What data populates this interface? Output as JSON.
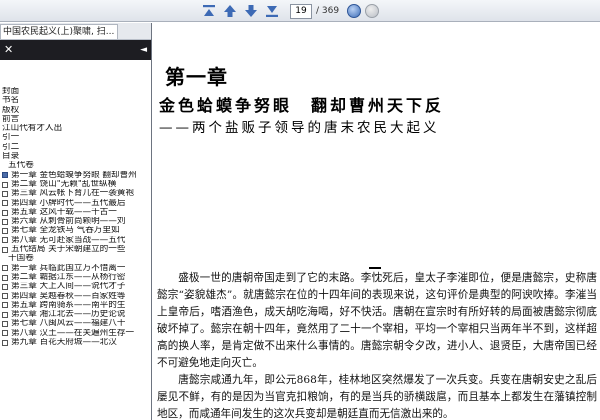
{
  "toolbar": {
    "page_value": "19",
    "page_total": "/ 369",
    "buttons": [
      "first-page-icon",
      "previous-page-icon",
      "next-page-icon",
      "last-page-icon"
    ],
    "accent": "#3f6fb8"
  },
  "sidebar": {
    "tab_title": "中国农民起义(上)聚啸, 扫...",
    "close_label": "✕",
    "items": [
      {
        "type": "plain",
        "text": "封面"
      },
      {
        "type": "plain",
        "text": "书名"
      },
      {
        "type": "plain",
        "text": "版权"
      },
      {
        "type": "plain",
        "text": "前言"
      },
      {
        "type": "plain",
        "text": "江山代有才人出"
      },
      {
        "type": "plain",
        "text": "引一"
      },
      {
        "type": "plain",
        "text": "引二"
      },
      {
        "type": "plain",
        "text": "目录"
      },
      {
        "type": "section",
        "text": "五代卷"
      },
      {
        "type": "sel",
        "text": "第一章  金色蛤蟆争努眼  翻却曹州"
      },
      {
        "type": "box",
        "text": "第二章  饶山\"无赖\"乱世纵横"
      },
      {
        "type": "box",
        "text": "第三章  风云帐下育儿在一袭黄袍"
      },
      {
        "type": "box",
        "text": "第四章  小牌时代——五代最后"
      },
      {
        "type": "box",
        "text": "第五章  这风干载——千古一"
      },
      {
        "type": "box",
        "text": "第六章  从刺骨前尚颗明——刘"
      },
      {
        "type": "box",
        "text": "第七章  全龙铁马  气吞万里如"
      },
      {
        "type": "box",
        "text": "第八章  无可赴家当战——五代"
      },
      {
        "type": "box",
        "text": "五代结局  关于宋朝建立的一些"
      },
      {
        "type": "section",
        "text": "十国卷"
      },
      {
        "type": "box",
        "text": "第一章  兵临此国立万不惜离一"
      },
      {
        "type": "box",
        "text": "第二章  霸据江东——从杨行密"
      },
      {
        "type": "box",
        "text": "第三章  大上人间——说代才子"
      },
      {
        "type": "box",
        "text": "第四章  吴越春秋——百家姓等"
      },
      {
        "type": "box",
        "text": "第五章  跨南骑系——南平的生"
      },
      {
        "type": "box",
        "text": "第六章  湘江北去——历史论说"
      },
      {
        "type": "box",
        "text": "第七章  八闽风云——福建八十"
      },
      {
        "type": "box",
        "text": "第八章  汉土——在关遍州生存一"
      },
      {
        "type": "box",
        "text": "第九章  百花天府城——北汉"
      }
    ]
  },
  "document": {
    "chapter_title": "第一章",
    "subtitle": "金色蛤蟆争努眼　翻却曹州天下反",
    "subtitle2": "——两个盐贩子领导的唐末农民大起义",
    "separator": "—",
    "paragraphs": [
      "盛极一世的唐朝帝国走到了它的末路。李忱死后，皇太子李漼即位，便是唐懿宗，史称唐懿宗“姿貌雄杰”。就唐懿宗在位的十四年间的表现来说，这句评价是典型的阿谀吹捧。李漼当上皇帝后，嗜酒渔色，成天胡吃海喝，好不快活。唐朝在宣宗时有所好转的局面被唐懿宗彻底破坏掉了。懿宗在朝十四年，竟然用了二十一个宰相，平均一个宰相只当两年半不到，这样超高的换人率，是肯定做不出来什么事情的。唐懿宗朝令夕改，进小人、退贤臣，大唐帝国已经不可避免地走向灭亡。",
      "唐懿宗咸通九年，即公元868年，桂林地区突然爆发了一次兵变。兵变在唐朝安史之乱后屡见不鲜，有的是因为当官克扣粮饷，有的是当兵的骄横跋扈，而且基本上都发生在藩镇控制地区，而咸通年间发生的这次兵变却是朝廷直而无信激出来的。"
    ]
  }
}
